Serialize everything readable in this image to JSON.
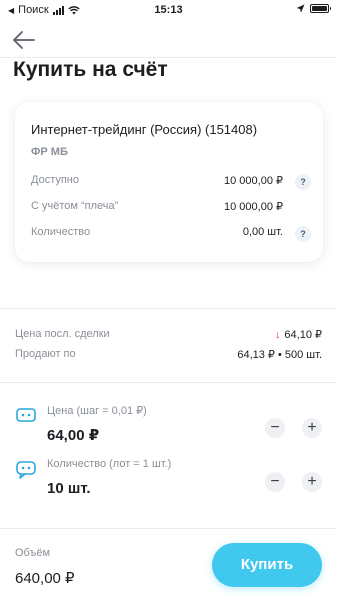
{
  "status_bar": {
    "carrier": "Поиск",
    "time": "15:13"
  },
  "header": {
    "title": "Купить на счёт"
  },
  "account": {
    "name": "Интернет-трейдинг (Россия) (151408)",
    "subtitle": "ФР МБ",
    "rows": [
      {
        "label": "Доступно",
        "value": "10 000,00 ₽",
        "help": "?"
      },
      {
        "label": "С учётом “плеча”",
        "value": "10 000,00 ₽"
      },
      {
        "label": "Количество",
        "value": "0,00 шт.",
        "help": "?"
      }
    ]
  },
  "market": {
    "last_price_label": "Цена посл. сделки",
    "last_price_value": "64,10 ₽",
    "sell_label": "Продают по",
    "sell_value": "64,13 ₽ • 500 шт."
  },
  "order": {
    "price_label": "Цена (шаг = 0,01 ₽)",
    "price_value": "64,00 ₽",
    "qty_label": "Количество (лот = 1 шт.)",
    "qty_value": "10 шт.",
    "minus": "−",
    "plus": "+"
  },
  "footer": {
    "volume_label": "Объём",
    "volume_value": "640,00 ₽",
    "buy_label": "Купить"
  },
  "colors": {
    "accent": "#41c8ee",
    "price_down": "#e0314b",
    "icon_blue": "#2aa7dc"
  }
}
